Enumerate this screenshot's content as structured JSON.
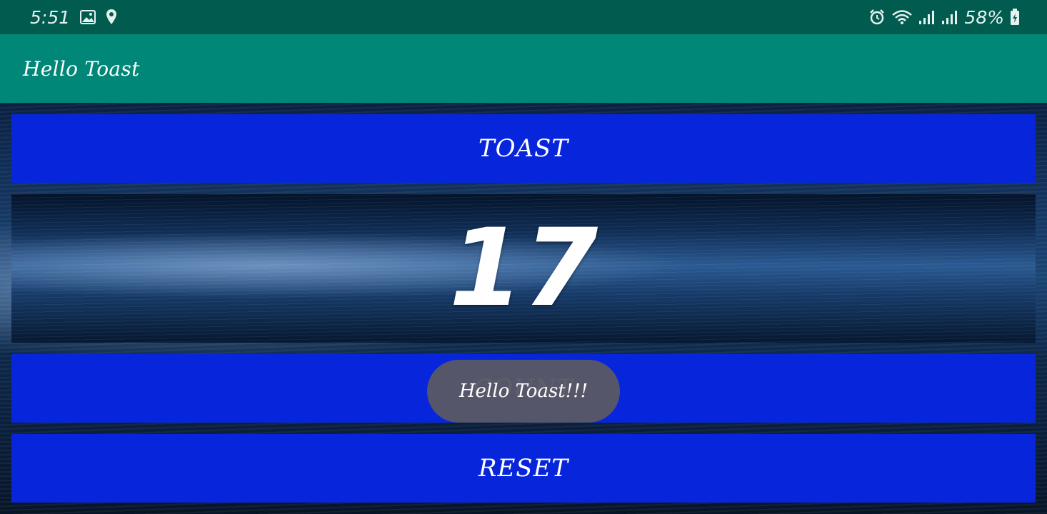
{
  "status_bar": {
    "time": "5:51",
    "battery": "58%",
    "icons": [
      "image-icon",
      "location-icon",
      "alarm-icon",
      "wifi-icon",
      "signal-icon",
      "signal-icon",
      "battery-charging-icon"
    ]
  },
  "app_bar": {
    "title": "Hello Toast"
  },
  "buttons": {
    "toast": "TOAST",
    "count": "COUNT",
    "reset": "RESET"
  },
  "counter": {
    "value": "17"
  },
  "toast_message": "Hello Toast!!!",
  "colors": {
    "status_bar": "#015c4f",
    "app_bar": "#018777",
    "button": "#0726dc",
    "toast": "#585864"
  }
}
